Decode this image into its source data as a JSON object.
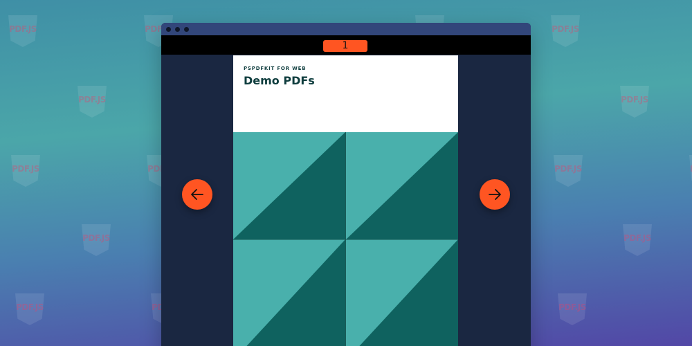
{
  "background": {
    "logo_text": "PDF.JS",
    "gradient_colors": [
      "#3f8fa6",
      "#4ba6a9",
      "#4a7fb0",
      "#5247a6"
    ]
  },
  "window": {
    "titlebar_color": "#32467a",
    "controls": [
      "window-dot",
      "window-dot",
      "window-dot"
    ]
  },
  "toolbar": {
    "current_page": "1",
    "indicator_color": "#ff5522"
  },
  "document": {
    "kicker": "PSPDFKIT FOR WEB",
    "title": "Demo PDFs",
    "colors": {
      "light_teal": "#49b0ac",
      "dark_teal": "#0f625f",
      "text": "#0f3d3e"
    }
  },
  "navigation": {
    "previous_icon": "arrow-left-icon",
    "next_icon": "arrow-right-icon",
    "button_color": "#ff5522"
  }
}
